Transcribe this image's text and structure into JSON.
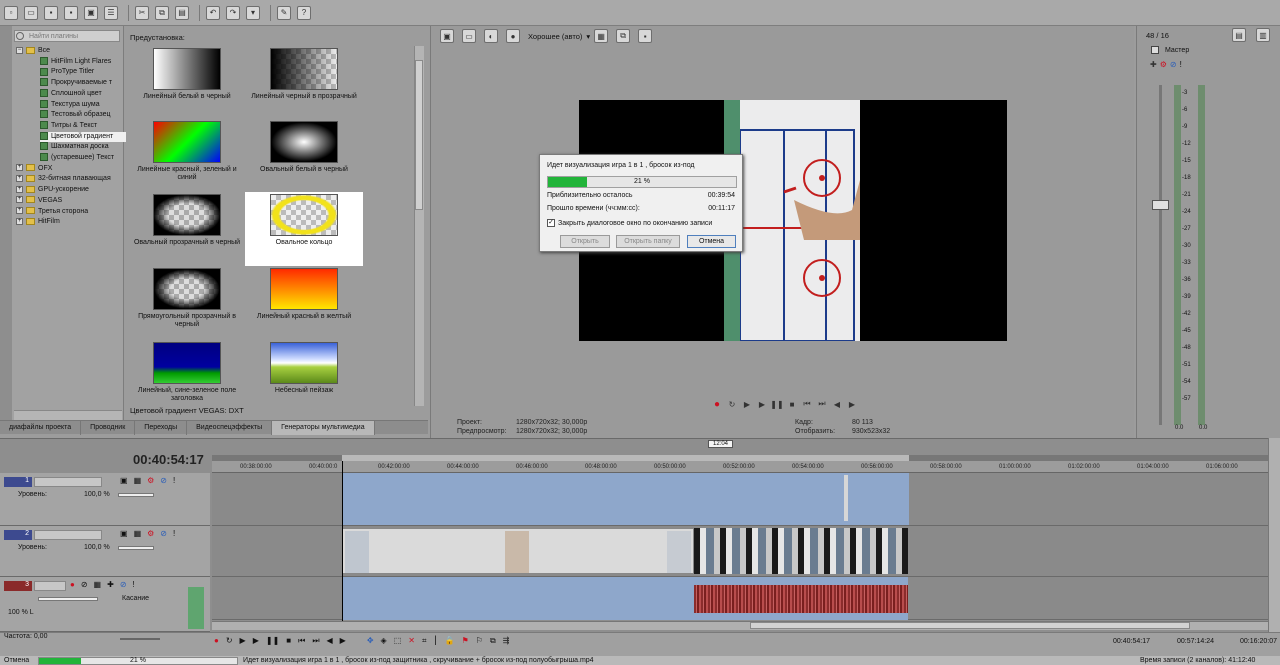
{
  "toolbar": {
    "icons": [
      "new-icon",
      "open-icon",
      "save-icon",
      "save-as-icon",
      "render-icon",
      "properties-icon",
      "cut-icon",
      "copy-icon",
      "paste-icon",
      "undo-icon",
      "redo-icon",
      "history-icon",
      "snapshot-icon",
      "whats-this-icon"
    ]
  },
  "tree": {
    "search_placeholder": "Найти плагины",
    "items": [
      {
        "label": "Все",
        "level": 0,
        "type": "folder-open"
      },
      {
        "label": "HitFilm Light Flares",
        "level": 1,
        "type": "fx"
      },
      {
        "label": "ProType Titler",
        "level": 1,
        "type": "fx"
      },
      {
        "label": "Прокручиваемые т",
        "level": 1,
        "type": "fx"
      },
      {
        "label": "Сплошной цвет",
        "level": 1,
        "type": "fx"
      },
      {
        "label": "Текстура шума",
        "level": 1,
        "type": "fx"
      },
      {
        "label": "Тестовый образец",
        "level": 1,
        "type": "fx"
      },
      {
        "label": "Титры & Текст",
        "level": 1,
        "type": "fx"
      },
      {
        "label": "Цветовой градиент",
        "level": 1,
        "type": "fx",
        "selected": true
      },
      {
        "label": "Шахматная доска",
        "level": 1,
        "type": "fx"
      },
      {
        "label": "(устаревшее) Текст",
        "level": 1,
        "type": "fx"
      },
      {
        "label": "OFX",
        "level": 0,
        "type": "folder"
      },
      {
        "label": "32-битная плавающая",
        "level": 0,
        "type": "folder"
      },
      {
        "label": "GPU-ускорение",
        "level": 0,
        "type": "folder"
      },
      {
        "label": "VEGAS",
        "level": 0,
        "type": "folder"
      },
      {
        "label": "Третья сторона",
        "level": 0,
        "type": "folder"
      },
      {
        "label": "HitFilm",
        "level": 0,
        "type": "folder"
      }
    ]
  },
  "presets": {
    "label": "Предустановка:",
    "footer": "Цветовой градиент VEGAS: DXT",
    "tiles": [
      {
        "caption": "Линейный белый в черный"
      },
      {
        "caption": "Линейный черный в прозрачный"
      },
      {
        "caption": "Линейные красный, зеленый и синий"
      },
      {
        "caption": "Овальный белый в черный"
      },
      {
        "caption": "Овальный прозрачный в черный"
      },
      {
        "caption": "Овальное кольцо"
      },
      {
        "caption": "Прямоугольный прозрачный в черный"
      },
      {
        "caption": "Линейный красный в желтый"
      },
      {
        "caption": "Линейный, сине-зеленое поле заголовка"
      },
      {
        "caption": "Небесный пейзаж"
      }
    ]
  },
  "tabs": [
    "диафайлы проекта",
    "Проводник",
    "Переходы",
    "Видеоспецэффекты",
    "Генераторы мультимедиа"
  ],
  "preview": {
    "quality": "Хорошее (авто)",
    "project_label": "Проект:",
    "project_value": "1280x720x32; 30,000p",
    "preview_label": "Предпросмотр:",
    "preview_value": "1280x720x32; 30,000p",
    "frame_label": "Кадр:",
    "frame_value": "80 113",
    "display_label": "Отобразить:",
    "display_value": "930x523x32"
  },
  "dialog": {
    "title": "Идет визуализация игра 1 в 1 , бросок из-под",
    "progress_text": "21 %",
    "progress": 0.21,
    "remaining_label": "Приблизительно осталось",
    "remaining_value": "00:39:54",
    "elapsed_label": "Прошло времени (чч:мм:сс):",
    "elapsed_value": "00:11:17",
    "close_check": "Закрыть диалоговое окно по окончанию записи",
    "open_btn": "Открыть",
    "open_folder_btn": "Открыть папку",
    "cancel_btn": "Отмена"
  },
  "mixer": {
    "channels": "48 / 16",
    "title": "Мастер",
    "scale": [
      "3",
      "6",
      "9",
      "12",
      "15",
      "18",
      "21",
      "24",
      "27",
      "30",
      "33",
      "36",
      "39",
      "42",
      "45",
      "48",
      "51",
      "54",
      "57"
    ],
    "left_value": "0.0",
    "right_value": "0.0"
  },
  "timeline": {
    "timecode": "00:40:54:17",
    "cursor_label": "12:04",
    "ruler": [
      "00:38:00:00",
      "00:40:00:0",
      "00:42:00:00",
      "00:44:00:00",
      "00:46:00:00",
      "00:48:00:00",
      "00:50:00:00",
      "00:52:00:00",
      "00:54:00:00",
      "00:56:00:00",
      "00:58:00:00",
      "01:00:00:00",
      "01:02:00:00",
      "01:04:00:00",
      "01:06:00:00"
    ],
    "tracks": [
      {
        "num": "1",
        "level_label": "Уровень:",
        "level_value": "100,0 %"
      },
      {
        "num": "2",
        "level_label": "Уровень:",
        "level_value": "100,0 %"
      },
      {
        "num": "3",
        "mode": "Касание",
        "vol": "100 % L"
      }
    ]
  },
  "bottom": {
    "rate": "Частота: 0,00",
    "time1": "00:40:54:17",
    "time2": "00:57:14:24",
    "time3": "00:16:20:07"
  },
  "status": {
    "cancel": "Отмена",
    "percent": "21 %",
    "message": "Идет визуализация игра 1 в 1 , бросок из-под защитника , скручивание + бросок из-под полуобыгрыша.mp4",
    "record_time": "Время записи (2 каналов): 41:12:40"
  },
  "colors": {
    "progress": "#22b43a",
    "accent": "#4f7fbd"
  }
}
